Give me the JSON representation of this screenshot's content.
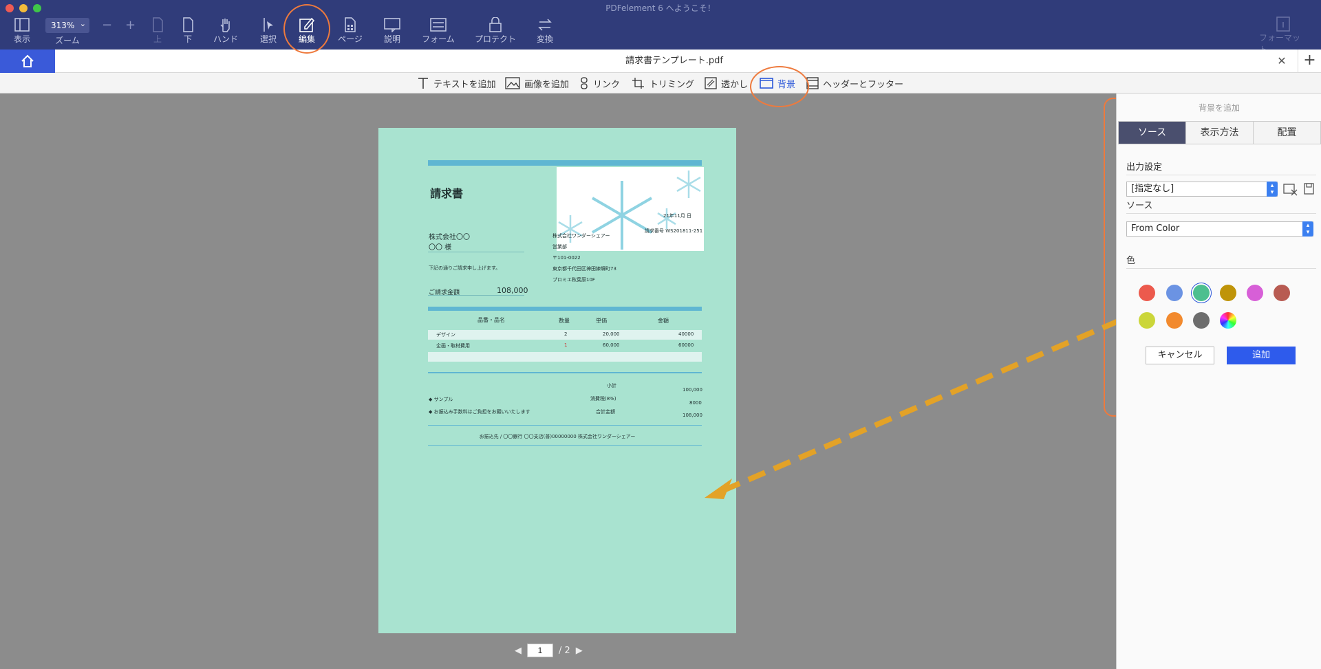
{
  "app_title": "PDFelement 6 へようこそ！",
  "toolbar": {
    "zoom_value": "313%",
    "buttons": {
      "view": "表示",
      "zoom": "ズーム",
      "up": "上",
      "down": "下",
      "hand": "ハンド",
      "select": "選択",
      "edit": "編集",
      "page": "ページ",
      "comment": "説明",
      "form": "フォーム",
      "protect": "プロテクト",
      "convert": "変換",
      "format": "フォーマット"
    }
  },
  "tab": {
    "title": "請求書テンプレート.pdf",
    "close": "✕",
    "add": "+"
  },
  "editbar": {
    "add_text": "テキストを追加",
    "add_image": "画像を追加",
    "link": "リンク",
    "crop": "トリミング",
    "watermark": "透かし",
    "background": "背景",
    "header_footer": "ヘッダーとフッター"
  },
  "document": {
    "title": "請求書",
    "date": "21年11月 日",
    "invoice_no": "請求番号 WS201811-251",
    "client": "株式会社〇〇",
    "client_name": "〇〇 様",
    "company": "株式会社ワンダーシェアー",
    "dept": "営業部",
    "postal": "〒101-0022",
    "address": "東京都千代田区神田練塀町73",
    "building": "プロミエ秋葉原10F",
    "intro": "下記の通りご請求申し上げます。",
    "amount_label": "ご請求金額",
    "amount_value": "108,000",
    "table_headers": [
      "品番・品名",
      "数量",
      "単価",
      "金額"
    ],
    "rows": [
      [
        "デザイン",
        "2",
        "20,000",
        "40000"
      ],
      [
        "企画・取材費用",
        "1",
        "60,000",
        "60000"
      ],
      [
        "",
        "",
        "",
        ""
      ]
    ],
    "subtotal_label": "小計",
    "subtotal_value": "100,000",
    "tax_label": "消費税(8%)",
    "tax_value": "8000",
    "total_label": "合計金額",
    "total_value": "108,000",
    "note1": "サンプル",
    "note2": "お振込み手数料はご負担をお願いいたします",
    "bank": "お振込先 / 〇〇銀行 〇〇支店(普)00000000 株式会社ワンダーシェアー"
  },
  "pager": {
    "current": "1",
    "total": "/ 2"
  },
  "panel": {
    "title": "背景を追加",
    "tabs": [
      "ソース",
      "表示方法",
      "配置"
    ],
    "output_label": "出力設定",
    "output_value": "[指定なし]",
    "source_label": "ソース",
    "source_value": "From Color",
    "color_label": "色",
    "colors": [
      "#ec5a4d",
      "#6b93e3",
      "#4cbf8f",
      "#bf9409",
      "#d75fd7",
      "#b85b52",
      "#cbd63a",
      "#f28a2e",
      "#6d6d6d"
    ],
    "cancel": "キャンセル",
    "add": "追加"
  }
}
